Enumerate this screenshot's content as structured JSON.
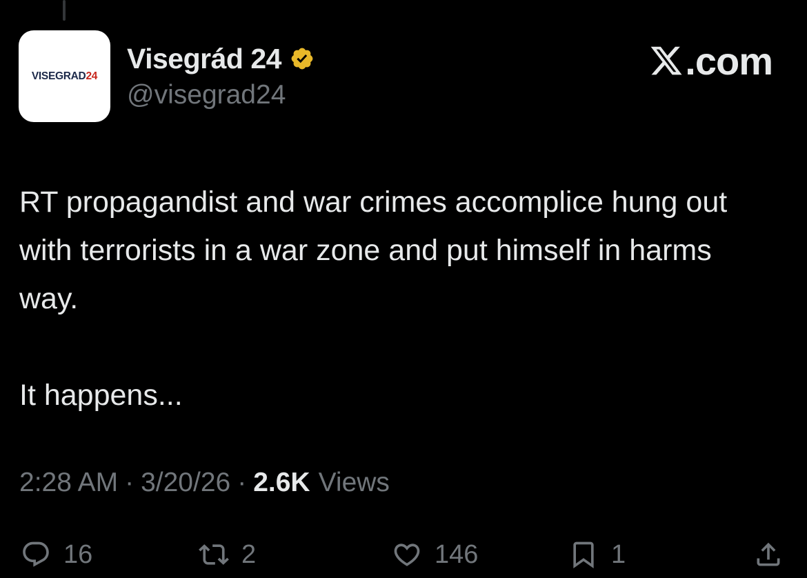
{
  "author": {
    "avatar_text_main": "VISEGRAD",
    "avatar_text_accent": "24",
    "display_name": "Visegrád 24",
    "handle": "@visegrad24",
    "verified_color": "#e8b829"
  },
  "brand": {
    "logo_icon": "x-logo-icon",
    "domain_suffix": ".com"
  },
  "tweet": {
    "paragraph_1": "RT propagandist and war crimes accomplice hung out with terrorists in a war zone and put himself in harms way.",
    "paragraph_2": "It happens..."
  },
  "meta": {
    "time": "2:28 AM",
    "date": "3/20/26",
    "views_count": "2.6K",
    "views_label": "Views",
    "separator": "·"
  },
  "actions": {
    "replies": "16",
    "reposts": "2",
    "likes": "146",
    "bookmarks": "1"
  },
  "colors": {
    "background": "#000000",
    "primary_text": "#e7e9ea",
    "secondary_text": "#71767b"
  }
}
